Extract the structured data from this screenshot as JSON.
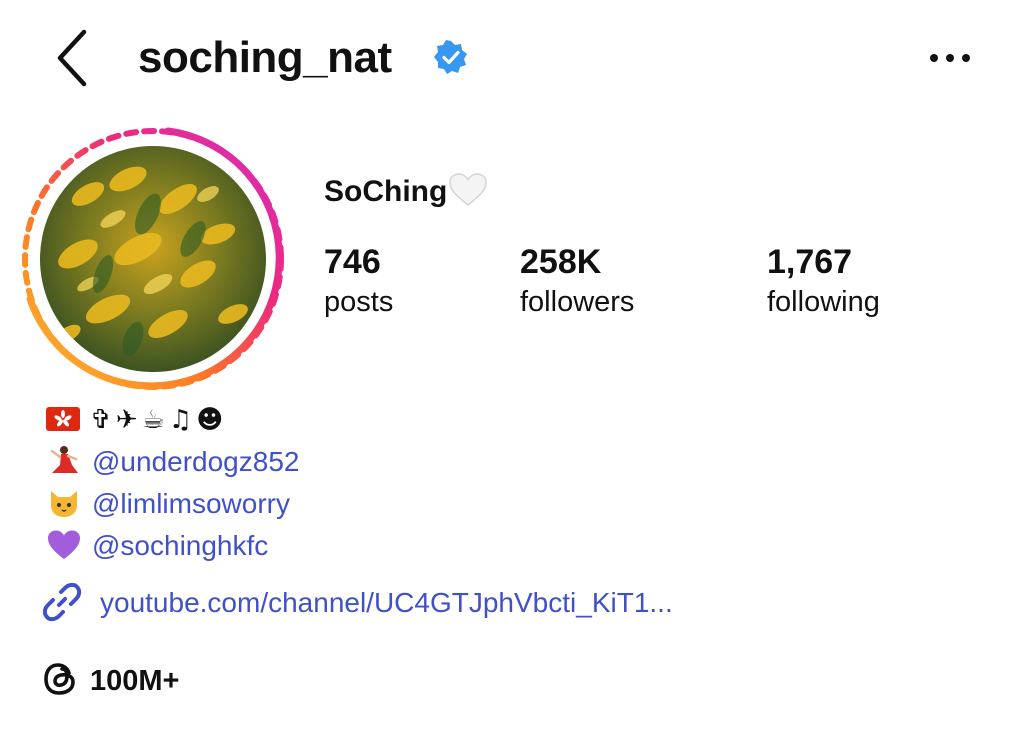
{
  "header": {
    "username": "soching_nat",
    "verified_icon": "verified-badge-icon",
    "back_icon": "chevron-left-icon",
    "more_icon": "more-horizontal-icon",
    "verified_color": "#3897f0"
  },
  "profile": {
    "display_name": "SoChing",
    "name_emoji": "🤍",
    "avatar_ring_colors": [
      "#f9ce34",
      "#ee2a7b",
      "#c13584"
    ]
  },
  "stats": [
    {
      "value": "746",
      "label": "posts"
    },
    {
      "value": "258K",
      "label": "followers"
    },
    {
      "value": "1,767",
      "label": "following"
    }
  ],
  "bio": {
    "emoji_line": "🇭🇰 ✞✈☕♫☻",
    "lines": [
      {
        "emoji": "dancer-emoji",
        "mention": "@underdogz852"
      },
      {
        "emoji": "cat-emoji",
        "mention": "@limlimsoworry"
      },
      {
        "emoji": "purple-heart-emoji",
        "mention": "@sochinghkfc"
      }
    ],
    "link_text": "youtube.com/channel/UC4GTJphVbcti_KiT1...",
    "link_icon": "link-icon",
    "link_color": "#4050c8"
  },
  "threads": {
    "icon": "threads-icon",
    "label": "100M+"
  }
}
